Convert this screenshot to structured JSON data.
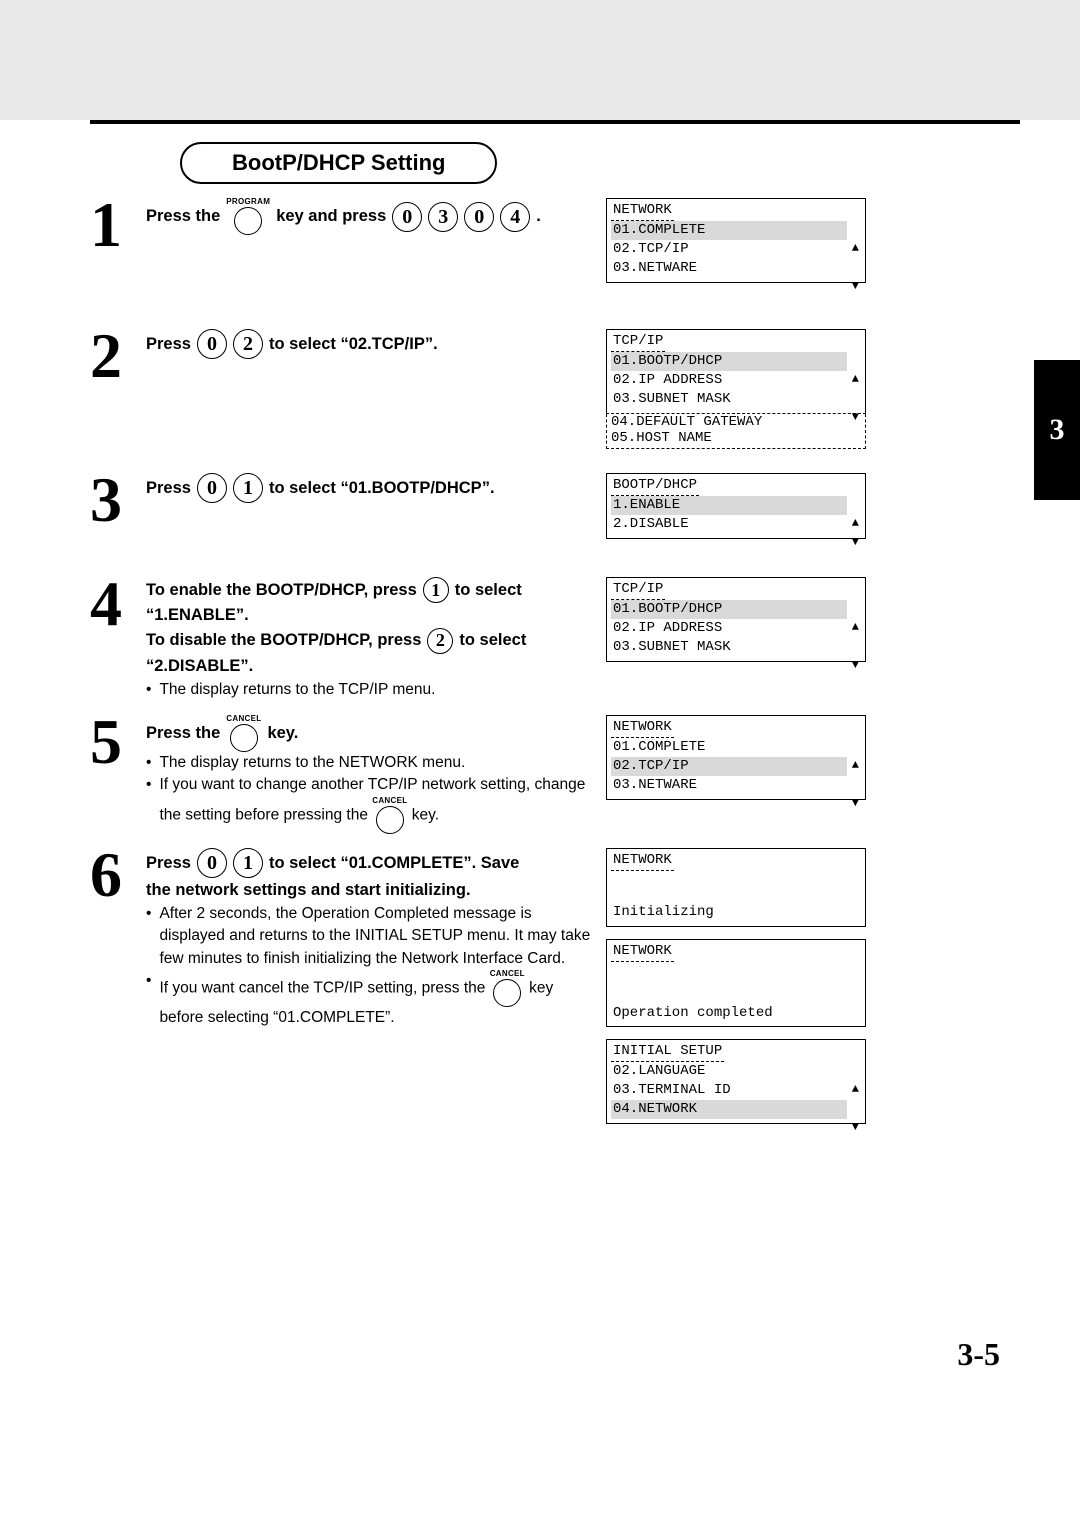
{
  "title": "BootP/DHCP Setting",
  "tab": "3",
  "page_num": "3-5",
  "keys": {
    "program": "PROGRAM",
    "cancel": "CANCEL"
  },
  "steps": {
    "s1": {
      "t1": "Press the",
      "t2": "key and press",
      "k": [
        "0",
        "3",
        "0",
        "4"
      ],
      "dot": "."
    },
    "s2": {
      "t1": "Press",
      "k": [
        "0",
        "2"
      ],
      "t2": "to select “02.TCP/IP”."
    },
    "s3": {
      "t1": "Press",
      "k": [
        "0",
        "1"
      ],
      "t2": "to select “01.BOOTP/DHCP”."
    },
    "s4": {
      "l1a": "To enable the BOOTP/DHCP, press",
      "l1k": "1",
      "l1b": "to select",
      "l2": "“1.ENABLE”.",
      "l3a": "To disable the BOOTP/DHCP, press",
      "l3k": "2",
      "l3b": "to select",
      "l4": "“2.DISABLE”.",
      "n1": "The display returns to the TCP/IP menu."
    },
    "s5": {
      "t1": "Press the",
      "t2": "key.",
      "n1": "The display returns to the NETWORK menu.",
      "n2a": "If you want to change another TCP/IP network setting, change the setting before pressing the",
      "n2b": "key."
    },
    "s6": {
      "t1": "Press",
      "k": [
        "0",
        "1"
      ],
      "t2": "to select “01.COMPLETE”. Save",
      "l2": "the network settings and start initializing.",
      "n1": "After 2 seconds, the Operation Completed message is displayed and returns to the INITIAL SETUP menu. It may take few minutes to finish initializing the Network Interface Card.",
      "n2a": "If you want cancel the TCP/IP setting, press the",
      "n2b": "key before selecting “01.COMPLETE”."
    }
  },
  "panels": {
    "p1": {
      "hdr": "NETWORK",
      "rows": [
        {
          "t": "01.COMPLETE",
          "hl": true,
          "up": true
        },
        {
          "t": "02.TCP/IP"
        },
        {
          "t": "03.NETWARE",
          "down": true
        }
      ]
    },
    "p2": {
      "hdr": "TCP/IP",
      "rows": [
        {
          "t": "01.BOOTP/DHCP",
          "hl": true,
          "up": true
        },
        {
          "t": "02.IP ADDRESS"
        },
        {
          "t": "03.SUBNET MASK",
          "down": true
        },
        {
          "t": "04.DEFAULT GATEWAY",
          "dashed": true
        },
        {
          "t": "05.HOST NAME",
          "dashed": true
        }
      ]
    },
    "p3": {
      "hdr": "BOOTP/DHCP",
      "rows": [
        {
          "t": "1.ENABLE",
          "hl": true,
          "up": true
        },
        {
          "t": "2.DISABLE"
        },
        {
          "t": " ",
          "down": true
        }
      ]
    },
    "p4": {
      "hdr": "TCP/IP",
      "rows": [
        {
          "t": "01.BOOTP/DHCP",
          "hl": true,
          "up": true
        },
        {
          "t": "02.IP ADDRESS"
        },
        {
          "t": "03.SUBNET MASK",
          "down": true
        }
      ]
    },
    "p5": {
      "hdr": "NETWORK",
      "rows": [
        {
          "t": "01.COMPLETE",
          "up": true
        },
        {
          "t": "02.TCP/IP",
          "hl": true
        },
        {
          "t": "03.NETWARE",
          "down": true
        }
      ]
    },
    "p6": {
      "hdr": "NETWORK",
      "mid": "Initializing"
    },
    "p7": {
      "hdr": "NETWORK",
      "low": "Operation completed"
    },
    "p8": {
      "hdr": "INITIAL SETUP",
      "rows": [
        {
          "t": "02.LANGUAGE",
          "up": true
        },
        {
          "t": "03.TERMINAL ID"
        },
        {
          "t": "04.NETWORK",
          "hl": true,
          "down": true
        }
      ]
    }
  }
}
